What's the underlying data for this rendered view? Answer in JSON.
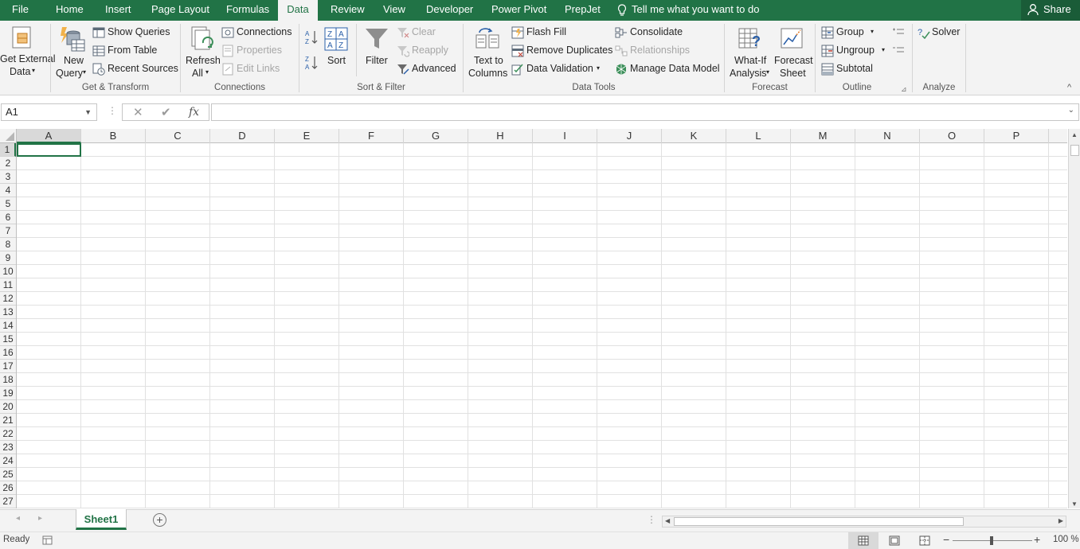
{
  "tabs": {
    "file": "File",
    "home": "Home",
    "insert": "Insert",
    "page_layout": "Page Layout",
    "formulas": "Formulas",
    "data": "Data",
    "review": "Review",
    "view": "View",
    "developer": "Developer",
    "power_pivot": "Power Pivot",
    "preplet": "PrepJet"
  },
  "tell_me": "Tell me what you want to do",
  "share": "Share",
  "ribbon": {
    "get_external": {
      "line1": "Get External",
      "line2": "Data"
    },
    "new_query": {
      "line1": "New",
      "line2": "Query"
    },
    "show_queries": "Show Queries",
    "from_table": "From Table",
    "recent_sources": "Recent Sources",
    "group_get_transform": "Get & Transform",
    "refresh": {
      "line1": "Refresh",
      "line2": "All"
    },
    "connections": "Connections",
    "properties": "Properties",
    "edit_links": "Edit Links",
    "group_connections": "Connections",
    "sort": "Sort",
    "filter": "Filter",
    "clear": "Clear",
    "reapply": "Reapply",
    "advanced": "Advanced",
    "group_sort_filter": "Sort & Filter",
    "text_to_columns": {
      "line1": "Text to",
      "line2": "Columns"
    },
    "flash_fill": "Flash Fill",
    "remove_duplicates": "Remove Duplicates",
    "data_validation": "Data Validation",
    "consolidate": "Consolidate",
    "relationships": "Relationships",
    "manage_data_model": "Manage Data Model",
    "group_data_tools": "Data Tools",
    "what_if": {
      "line1": "What-If",
      "line2": "Analysis"
    },
    "forecast_sheet": {
      "line1": "Forecast",
      "line2": "Sheet"
    },
    "group_forecast": "Forecast",
    "group": "Group",
    "ungroup": "Ungroup",
    "subtotal": "Subtotal",
    "group_outline": "Outline",
    "solver": "Solver",
    "group_analyze": "Analyze"
  },
  "formula_bar": {
    "name_box": "A1",
    "fx": "fx",
    "formula": ""
  },
  "columns": [
    "A",
    "B",
    "C",
    "D",
    "E",
    "F",
    "G",
    "H",
    "I",
    "J",
    "K",
    "L",
    "M",
    "N",
    "O",
    "P"
  ],
  "rows": [
    "1",
    "2",
    "3",
    "4",
    "5",
    "6",
    "7",
    "8",
    "9",
    "10",
    "11",
    "12",
    "13",
    "14",
    "15",
    "16",
    "17",
    "18",
    "19",
    "20",
    "21",
    "22",
    "23",
    "24",
    "25",
    "26",
    "27"
  ],
  "sheets": {
    "active": "Sheet1"
  },
  "status": {
    "ready": "Ready",
    "zoom": "100 %"
  },
  "colors": {
    "accent": "#217346",
    "ribbon_bg": "#f3f3f3"
  }
}
